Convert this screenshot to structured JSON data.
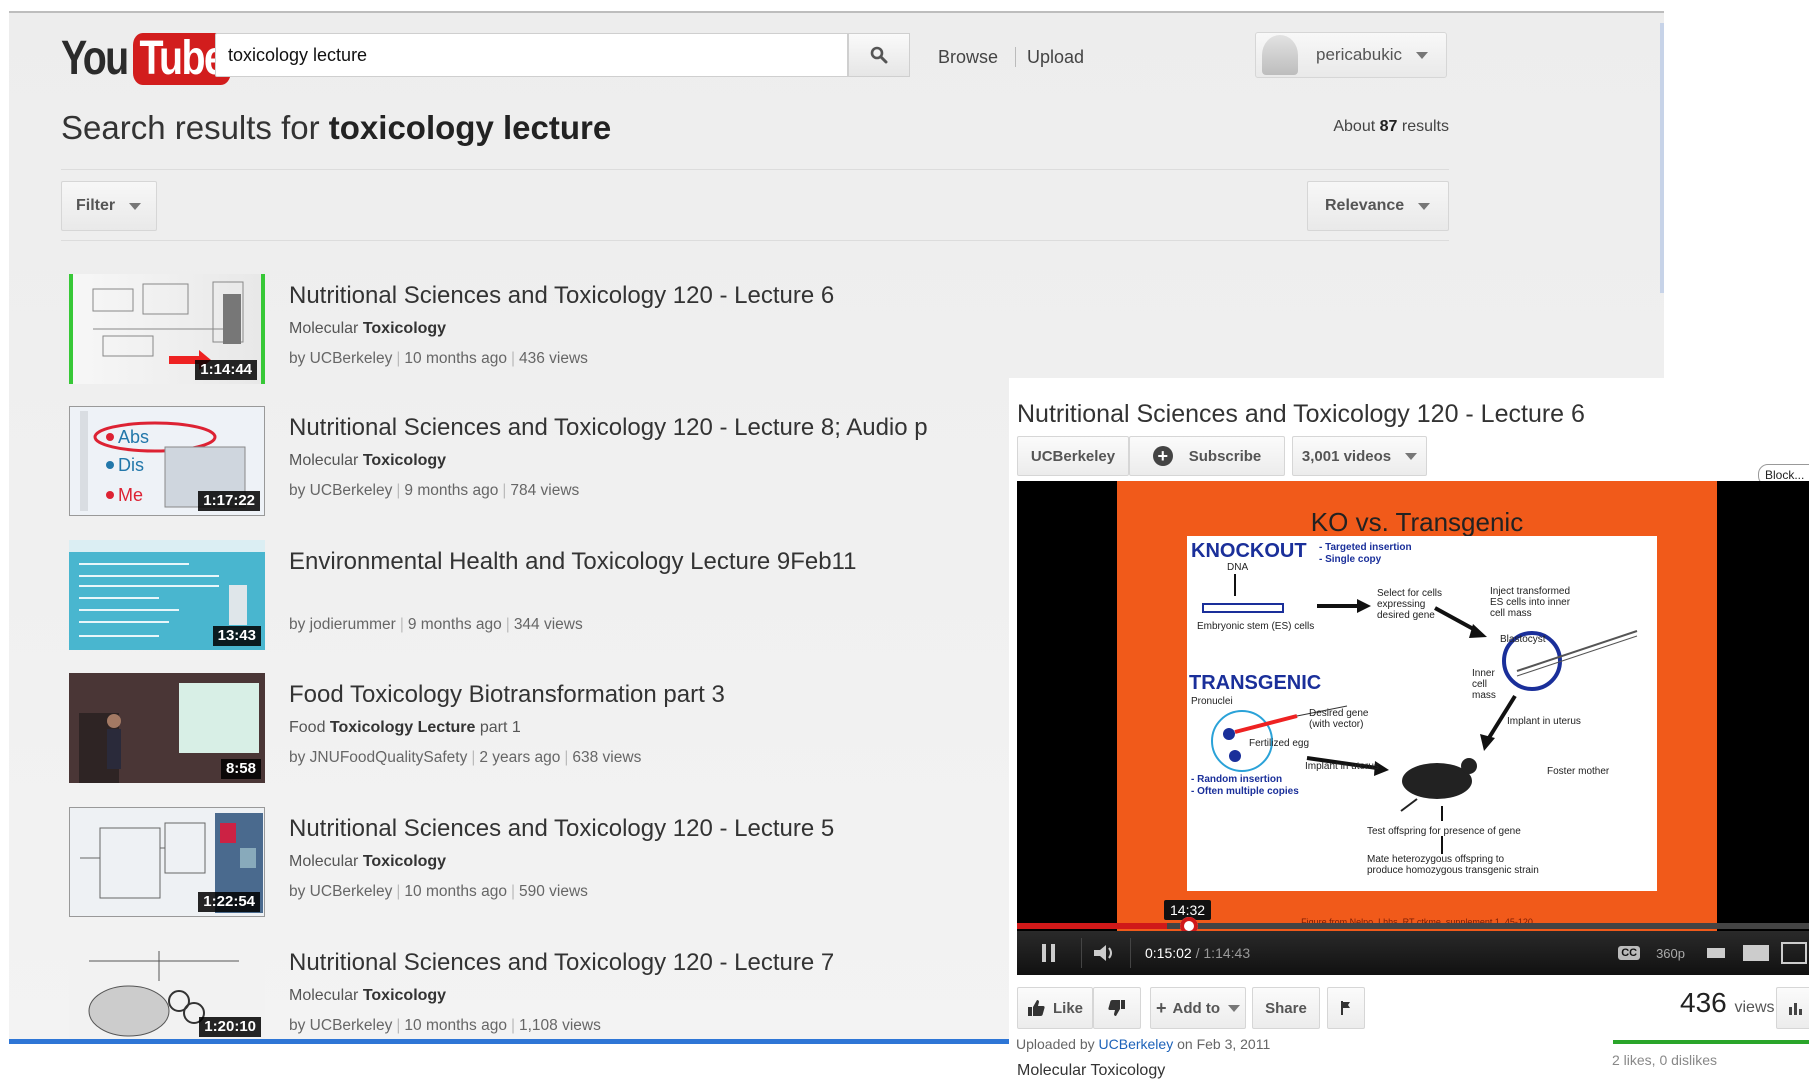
{
  "search_page": {
    "logo": {
      "you": "You",
      "tube": "Tube"
    },
    "search": {
      "value": "toxicology lecture",
      "button_icon": "search-icon"
    },
    "nav": {
      "browse": "Browse",
      "upload": "Upload"
    },
    "user": {
      "name": "pericabukic"
    },
    "heading": {
      "prefix": "Search results for ",
      "query": "toxicology lecture"
    },
    "count": {
      "prefix": "About ",
      "number": "87",
      "suffix": " results"
    },
    "filter_label": "Filter",
    "sort_label": "Relevance",
    "results": [
      {
        "title": "Nutritional Sciences and Toxicology 120 - Lecture 6",
        "desc_plain": "Molecular ",
        "desc_bold": "Toxicology",
        "desc_after": "",
        "channel": "by UCBerkeley",
        "age": "10 months ago",
        "views": "436 views",
        "duration": "1:14:44"
      },
      {
        "title": "Nutritional Sciences and Toxicology 120 - Lecture 8; Audio p",
        "desc_plain": "Molecular ",
        "desc_bold": "Toxicology",
        "desc_after": "",
        "channel": "by UCBerkeley",
        "age": "9 months ago",
        "views": "784 views",
        "duration": "1:17:22"
      },
      {
        "title": "Environmental Health and Toxicology Lecture 9Feb11",
        "desc_plain": "",
        "desc_bold": "",
        "desc_after": "",
        "channel": "by jodierummer",
        "age": "9 months ago",
        "views": "344 views",
        "duration": "13:43"
      },
      {
        "title": "Food Toxicology Biotransformation part 3",
        "desc_plain": "Food ",
        "desc_bold": "Toxicology Lecture",
        "desc_after": " part 1",
        "channel": "by JNUFoodQualitySafety",
        "age": "2 years ago",
        "views": "638 views",
        "duration": "8:58"
      },
      {
        "title": "Nutritional Sciences and Toxicology 120 - Lecture 5",
        "desc_plain": "Molecular ",
        "desc_bold": "Toxicology",
        "desc_after": "",
        "channel": "by UCBerkeley",
        "age": "10 months ago",
        "views": "590 views",
        "duration": "1:22:54"
      },
      {
        "title": "Nutritional Sciences and Toxicology 120 - Lecture 7",
        "desc_plain": "Molecular ",
        "desc_bold": "Toxicology",
        "desc_after": "",
        "channel": "by UCBerkeley",
        "age": "10 months ago",
        "views": "1,108 views",
        "duration": "1:20:10"
      }
    ]
  },
  "video_panel": {
    "title": "Nutritional Sciences and Toxicology 120 - Lecture 6",
    "channel_button": "UCBerkeley",
    "subscribe_label": "Subscribe",
    "videos_label": "3,001 videos",
    "block_label": "Block...",
    "slide": {
      "title": "KO vs. Transgenic",
      "knockout": "KNOCKOUT",
      "targeted": "- Targeted insertion",
      "single_copy": "- Single copy",
      "dna": "DNA",
      "es_cells": "Embryonic stem (ES) cells",
      "select": "Select for cells expressing desired gene",
      "inject": "Inject transformed ES cells into inner cell mass",
      "blastocyst": "Blastocyst",
      "inner_cell": "Inner cell mass",
      "transgenic": "TRANSGENIC",
      "pronuclei": "Pronuclei",
      "desired_gene": "Desired gene (with vector)",
      "fertilized": "Fertilized egg",
      "implant_uterus_1": "Implant in uterus",
      "implant_uterus_2": "Implant in uterus",
      "foster": "Foster mother",
      "random": "- Random insertion",
      "multiple": "- Often multiple copies",
      "test_offspring": "Test offspring for presence of gene",
      "mate": "Mate heterozygous offspring to produce homozygous transgenic strain",
      "footer": "Figure from Nelpo, Lhhs, RT ctkme, supplement 1, 45-120"
    },
    "player": {
      "tooltip_time": "14:32",
      "progress_fraction": 0.19,
      "current_time": "0:15:02",
      "total_time": "1:14:43",
      "quality": "360p",
      "cc_label": "CC"
    },
    "actions": {
      "like": "Like",
      "add_to": "Add to",
      "share": "Share"
    },
    "views_number": "436",
    "views_word": "views",
    "likes_text": "2 likes, 0 dislikes",
    "uploaded": {
      "prefix": "Uploaded by ",
      "channel": "UCBerkeley",
      "suffix": " on Feb 3, 2011"
    },
    "description": "Molecular Toxicology"
  },
  "colors": {
    "brand_red": "#d21d1d",
    "link_blue": "#1c62b9",
    "slide_orange": "#f15a1a",
    "progress_red": "#d01919"
  }
}
